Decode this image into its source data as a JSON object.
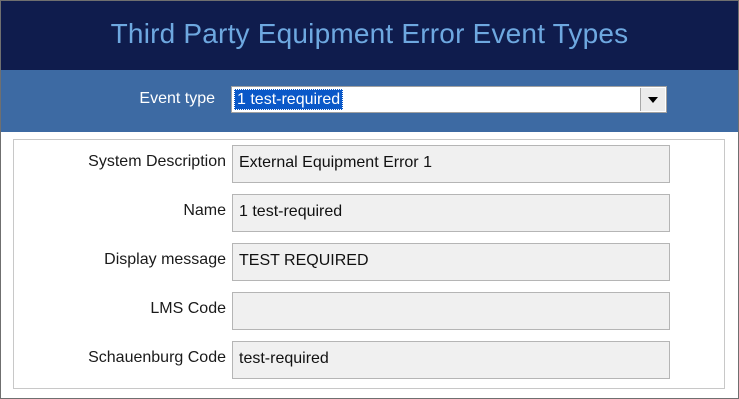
{
  "window": {
    "title": "Third Party Equipment Error Event Types"
  },
  "event_selector": {
    "label": "Event type",
    "selected_value": "1 test-required",
    "dropdown_icon": "chevron-down-icon"
  },
  "form": {
    "fields": [
      {
        "label": "System Description",
        "value": "External Equipment Error 1"
      },
      {
        "label": "Name",
        "value": "1 test-required"
      },
      {
        "label": "Display message",
        "value": "TEST REQUIRED"
      },
      {
        "label": "LMS Code",
        "value": ""
      },
      {
        "label": "Schauenburg Code",
        "value": "test-required"
      }
    ]
  },
  "colors": {
    "title_bar": "#0f1c4d",
    "title_text": "#6ea8e0",
    "event_bar": "#3d6aa3",
    "selection": "#0a58c8",
    "field_bg": "#f0f0f0"
  }
}
